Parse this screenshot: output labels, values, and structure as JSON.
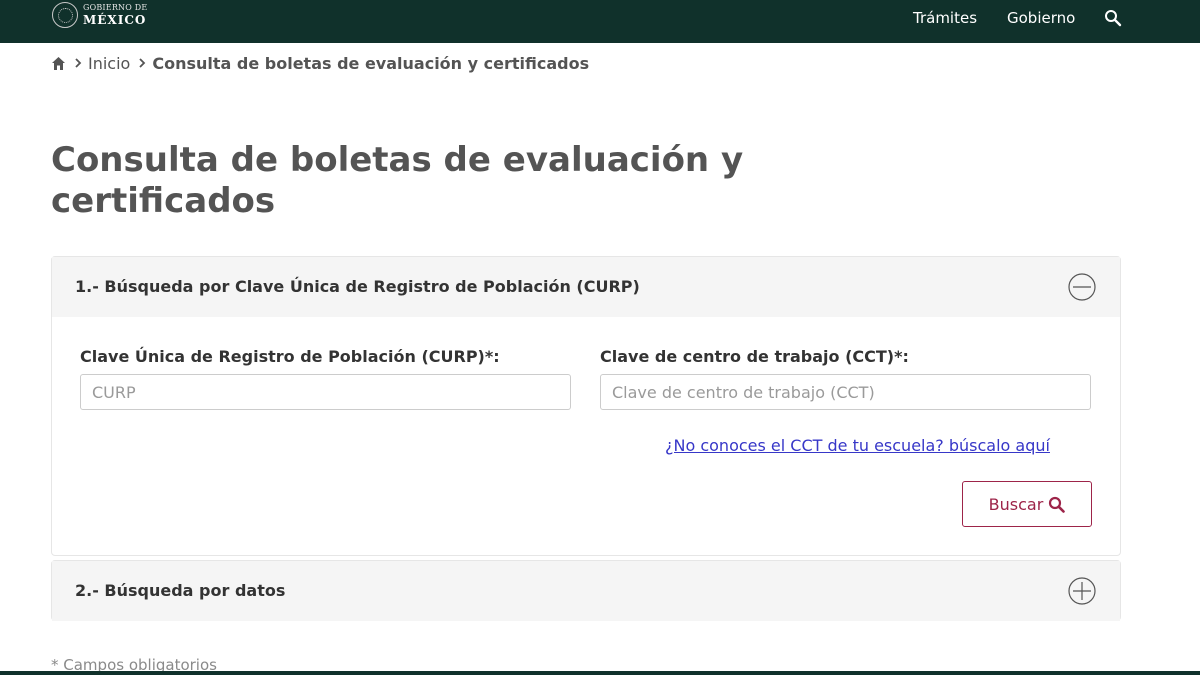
{
  "navbar": {
    "logo_small": "GOBIERNO DE",
    "logo_big": "MÉXICO",
    "links": [
      "Trámites",
      "Gobierno"
    ],
    "search_icon": "search-icon"
  },
  "breadcrumb": {
    "home_icon": "home-icon",
    "inicio": "Inicio",
    "current": "Consulta de boletas de evaluación y certificados"
  },
  "page_title": "Consulta de boletas de evaluación y certificados",
  "panel1": {
    "title": "1.- Búsqueda por Clave Única de Registro de Población (CURP)",
    "state": "expanded",
    "toggle_icon": "minus-circle-icon",
    "curp_label": "Clave Única de Registro de Población (CURP)*:",
    "curp_placeholder": "CURP",
    "cct_label": "Clave de centro de trabajo (CCT)*:",
    "cct_placeholder": "Clave de centro de trabajo (CCT)",
    "cct_link": "¿No conoces el CCT de tu escuela? búscalo aquí",
    "button_label": "Buscar"
  },
  "panel2": {
    "title": "2.- Búsqueda por datos",
    "state": "collapsed",
    "toggle_icon": "plus-circle-icon"
  },
  "footnote": "* Campos obligatorios",
  "colors": {
    "navbar": "#10312b",
    "accent": "#9d2449",
    "link": "#3737c8"
  }
}
